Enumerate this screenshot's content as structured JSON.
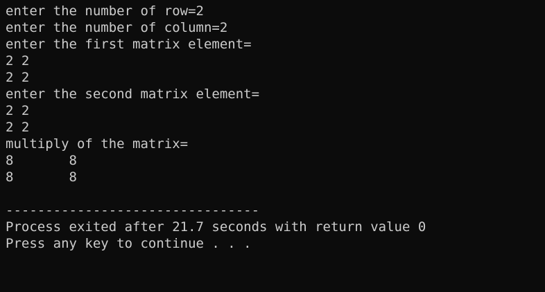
{
  "console": {
    "background": "#0c0c0c",
    "foreground": "#cccccc",
    "lines": [
      "enter the number of row=2",
      "enter the number of column=2",
      "enter the first matrix element=",
      "2 2",
      "2 2",
      "enter the second matrix element=",
      "2 2",
      "2 2",
      "multiply of the matrix=",
      "8       8",
      "8       8",
      "",
      "--------------------------------",
      "Process exited after 21.7 seconds with return value 0",
      "Press any key to continue . . ."
    ]
  }
}
